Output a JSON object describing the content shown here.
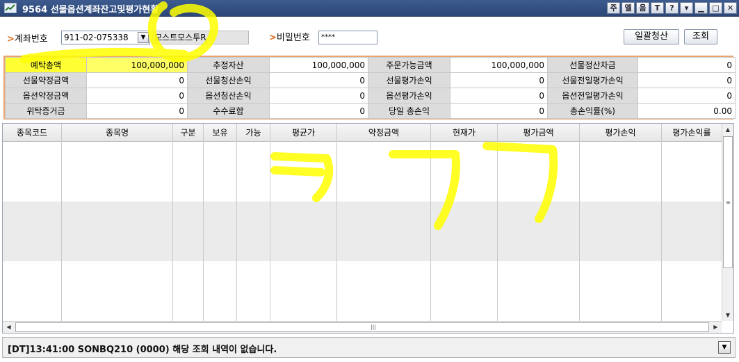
{
  "window": {
    "title": "9564 선물옵션계좌잔고및평가현황",
    "buttons": [
      "주",
      "엘",
      "음",
      "T",
      "?"
    ]
  },
  "account": {
    "label": "계좌번호",
    "number": "911-02-075338",
    "name": "모스트모스투R",
    "password_label": "비밀번호",
    "password_value": "****",
    "btn_settle": "일괄청산",
    "btn_query": "조회"
  },
  "summary": {
    "rows": [
      [
        {
          "label": "예탁총액",
          "value": "100,000,000",
          "hl": true
        },
        {
          "label": "추정자산",
          "value": "100,000,000"
        },
        {
          "label": "주문가능금액",
          "value": "100,000,000"
        },
        {
          "label": "선물정산차금",
          "value": "0"
        }
      ],
      [
        {
          "label": "선물약정금액",
          "value": "0"
        },
        {
          "label": "선물청산손익",
          "value": "0"
        },
        {
          "label": "선물평가손익",
          "value": "0"
        },
        {
          "label": "선물전일평가손익",
          "value": "0"
        }
      ],
      [
        {
          "label": "옵션약정금액",
          "value": "0"
        },
        {
          "label": "옵션청산손익",
          "value": "0"
        },
        {
          "label": "옵션평가손익",
          "value": "0"
        },
        {
          "label": "옵션전일평가손익",
          "value": "0"
        }
      ],
      [
        {
          "label": "위탁증거금",
          "value": "0"
        },
        {
          "label": "수수료합",
          "value": "0"
        },
        {
          "label": "당일 총손익",
          "value": "0"
        },
        {
          "label": "총손익률(%)",
          "value": "0.00"
        }
      ]
    ]
  },
  "grid": {
    "columns": [
      "종목코드",
      "종목명",
      "구분",
      "보유",
      "가능",
      "평균가",
      "약정금액",
      "현재가",
      "평가금액",
      "평가손익",
      "평가손익률"
    ]
  },
  "status": {
    "message": "[DT]13:41:00 SONBQ210 (0000) 해당 조회 내역이 없습니다."
  },
  "colors": {
    "titlebar": "#2b4677",
    "summary_border": "#e9a46f",
    "highlight": "#ffff33",
    "annotation": "#ffff00"
  }
}
